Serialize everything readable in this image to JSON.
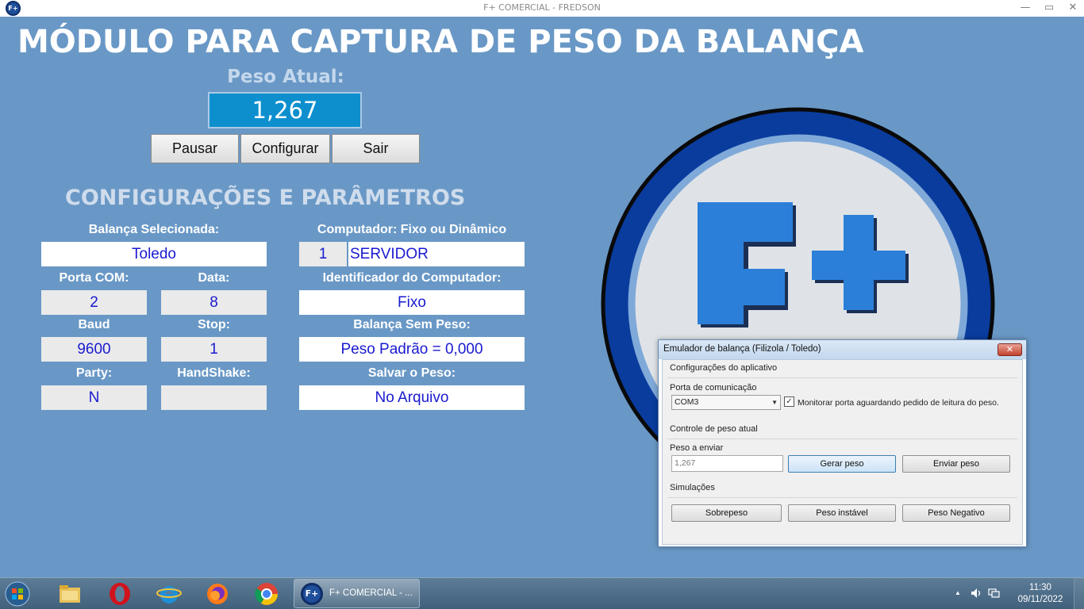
{
  "window": {
    "title": "F+ COMERCIAL - FREDSON",
    "minimize": "—",
    "restore": "▭",
    "close": "✕",
    "app_icon_text": "F+"
  },
  "main": {
    "title": "MÓDULO PARA CAPTURA DE PESO DA BALANÇA",
    "peso_label": "Peso Atual:",
    "peso_value": "1,267",
    "buttons": {
      "pausar": "Pausar",
      "configurar": "Configurar",
      "sair": "Sair"
    },
    "section_title": "CONFIGURAÇÕES E PARÂMETROS",
    "params": {
      "balanca_label": "Balança Selecionada:",
      "balanca_value": "Toledo",
      "porta_label": "Porta COM:",
      "porta_value": "2",
      "data_label": "Data:",
      "data_value": "8",
      "baud_label": "Baud",
      "baud_value": "9600",
      "stop_label": "Stop:",
      "stop_value": "1",
      "party_label": "Party:",
      "party_value": "N",
      "handshake_label": "HandShake:",
      "handshake_value": "",
      "computador_label": "Computador: Fixo ou Dinâmico",
      "computador_num": "1",
      "computador_value": "SERVIDOR",
      "identificador_label": "Identificador do Computador:",
      "identificador_value": "Fixo",
      "sem_peso_label": "Balança Sem Peso:",
      "sem_peso_value": "Peso Padrão = 0,000",
      "salvar_label": "Salvar o Peso:",
      "salvar_value": "No Arquivo"
    },
    "logo_text": "F+",
    "colors": {
      "background": "#6998c6",
      "peso_box": "#0d8fce",
      "value_text": "#1a1ad0",
      "logo_ring": "#0a3c9e",
      "logo_letters": "#2b7fd8"
    }
  },
  "emulator": {
    "title": "Emulador de balança (Filizola / Toledo)",
    "close": "✕",
    "group_app": "Configurações do aplicativo",
    "porta_label": "Porta de comunicação",
    "porta_value": "COM3",
    "monitor_checked": true,
    "monitor_label": "Monitorar porta aguardando pedido de leitura do peso.",
    "group_peso": "Controle de peso atual",
    "peso_enviar_label": "Peso a enviar",
    "peso_enviar_value": "1,267",
    "gerar_peso": "Gerar peso",
    "enviar_peso": "Enviar peso",
    "group_sim": "Simulações",
    "sobrepeso": "Sobrepeso",
    "peso_instavel": "Peso instável",
    "peso_negativo": "Peso Negativo"
  },
  "taskbar": {
    "task_label": "F+ COMERCIAL - ...",
    "task_icon_text": "F+",
    "time": "11:30",
    "date": "09/11/2022",
    "icons": [
      "windows-start-icon",
      "file-explorer-icon",
      "opera-icon",
      "internet-explorer-icon",
      "firefox-icon",
      "chrome-icon"
    ]
  }
}
